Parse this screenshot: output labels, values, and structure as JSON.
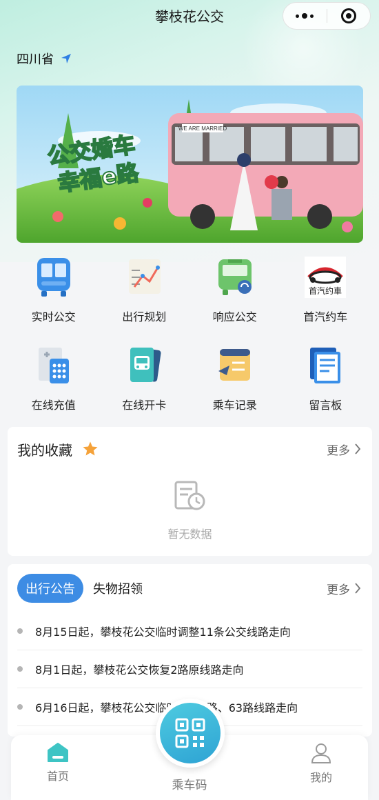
{
  "nav": {
    "title": "攀枝花公交"
  },
  "location": {
    "province": "四川省"
  },
  "banner": {
    "slogan_line1": "公交婚车",
    "slogan_line2": "幸福e路",
    "bus_sign": "WE ARE MARRIED"
  },
  "quick_actions": [
    {
      "label": "实时公交",
      "icon": "bus-icon"
    },
    {
      "label": "出行规划",
      "icon": "route-chart-icon"
    },
    {
      "label": "响应公交",
      "icon": "on-demand-bus-icon"
    },
    {
      "label": "首汽约车",
      "icon": "shouqi-logo-icon",
      "logo_text": "首汽约車"
    },
    {
      "label": "在线充值",
      "icon": "recharge-icon"
    },
    {
      "label": "在线开卡",
      "icon": "bus-card-icon"
    },
    {
      "label": "乘车记录",
      "icon": "ride-record-icon"
    },
    {
      "label": "留言板",
      "icon": "message-board-icon"
    }
  ],
  "favorites": {
    "title": "我的收藏",
    "more": "更多",
    "empty_text": "暂无数据"
  },
  "notices": {
    "tab_active": "出行公告",
    "tab_other": "失物招领",
    "more": "更多",
    "items": [
      "8月15日起，攀枝花公交临时调整11条公交线路走向",
      "8月1日起，攀枝花公交恢复2路原线路走向",
      "6月16日起，攀枝花公交临时调整8路、63路线路走向"
    ]
  },
  "tabbar": {
    "home": "首页",
    "qr": "乘车码",
    "mine": "我的"
  },
  "colors": {
    "accent": "#3d8ce4",
    "qr_button": "#3fb6dc",
    "star": "#f5a23a"
  }
}
